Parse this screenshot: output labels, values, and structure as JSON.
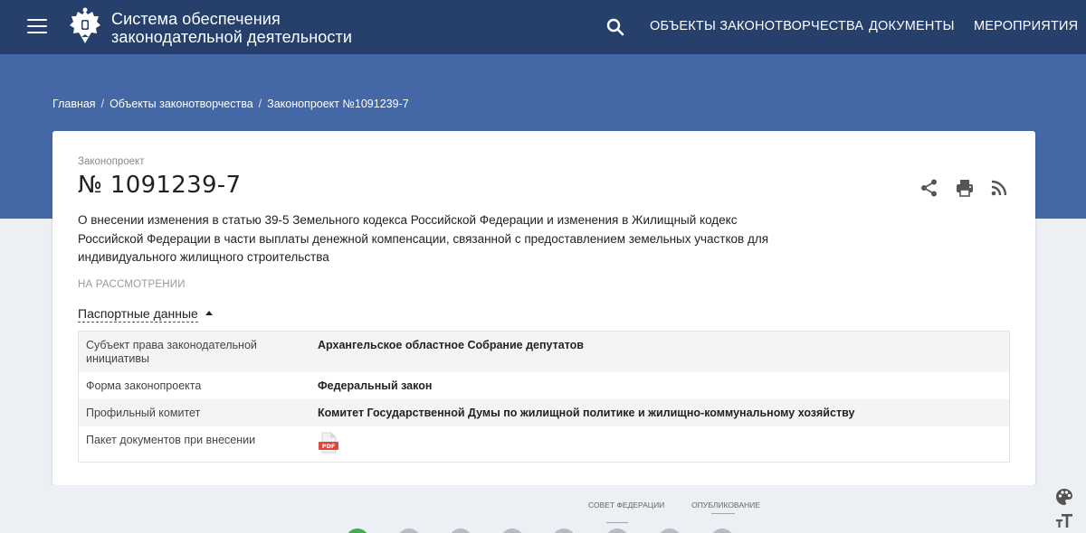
{
  "header": {
    "title_line1": "Система обеспечения",
    "title_line2": "законодательной деятельности",
    "nav": [
      {
        "label": "ОБЪЕКТЫ ЗАКОНОТВОРЧЕСТВА"
      },
      {
        "label": "ДОКУМЕНТЫ"
      },
      {
        "label": "МЕРОПРИЯТИЯ"
      }
    ],
    "icons": {
      "menu": "hamburger-icon",
      "emblem": "coat-of-arms-icon",
      "search": "search-icon"
    }
  },
  "breadcrumb": [
    {
      "label": "Главная"
    },
    {
      "label": "Объекты законотворчества"
    },
    {
      "label": "Законопроект №1091239-7"
    }
  ],
  "bill": {
    "type_label": "Законопроект",
    "number": "№ 1091239-7",
    "description": "О внесении изменения в статью 39-5 Земельного кодекса Российской Федерации и изменения в Жилищный кодекс Российской Федерации в части выплаты денежной компенсации, связанной с предоставлением земельных участков для индивидуального жилищного строительства",
    "status": "НА РАССМОТРЕНИИ",
    "actions": [
      "share-icon",
      "print-icon",
      "rss-icon"
    ]
  },
  "passport": {
    "toggle_label": "Паспортные данные",
    "rows": [
      {
        "key": "Субъект права законодательной инициативы",
        "value": "Архангельское областное Собрание депутатов"
      },
      {
        "key": "Форма законопроекта",
        "value": "Федеральный закон"
      },
      {
        "key": "Профильный комитет",
        "value": "Комитет Государственной Думы по жилищной политике и жилищно-коммунальному хозяйству"
      },
      {
        "key": "Пакет документов при внесении",
        "value": "",
        "icon": "pdf-icon"
      }
    ]
  },
  "stages": {
    "labels": [
      "СОВЕТ ФЕДЕРАЦИИ",
      "ОПУБЛИКОВАНИЕ"
    ],
    "dots": 8,
    "completed": 1
  },
  "side_tools": [
    "palette-icon",
    "font-size-icon"
  ],
  "colors": {
    "header_bg": "#26406b",
    "hero_bg": "#4468a6",
    "page_bg": "#eceff3",
    "done_green": "#3fae4f"
  }
}
